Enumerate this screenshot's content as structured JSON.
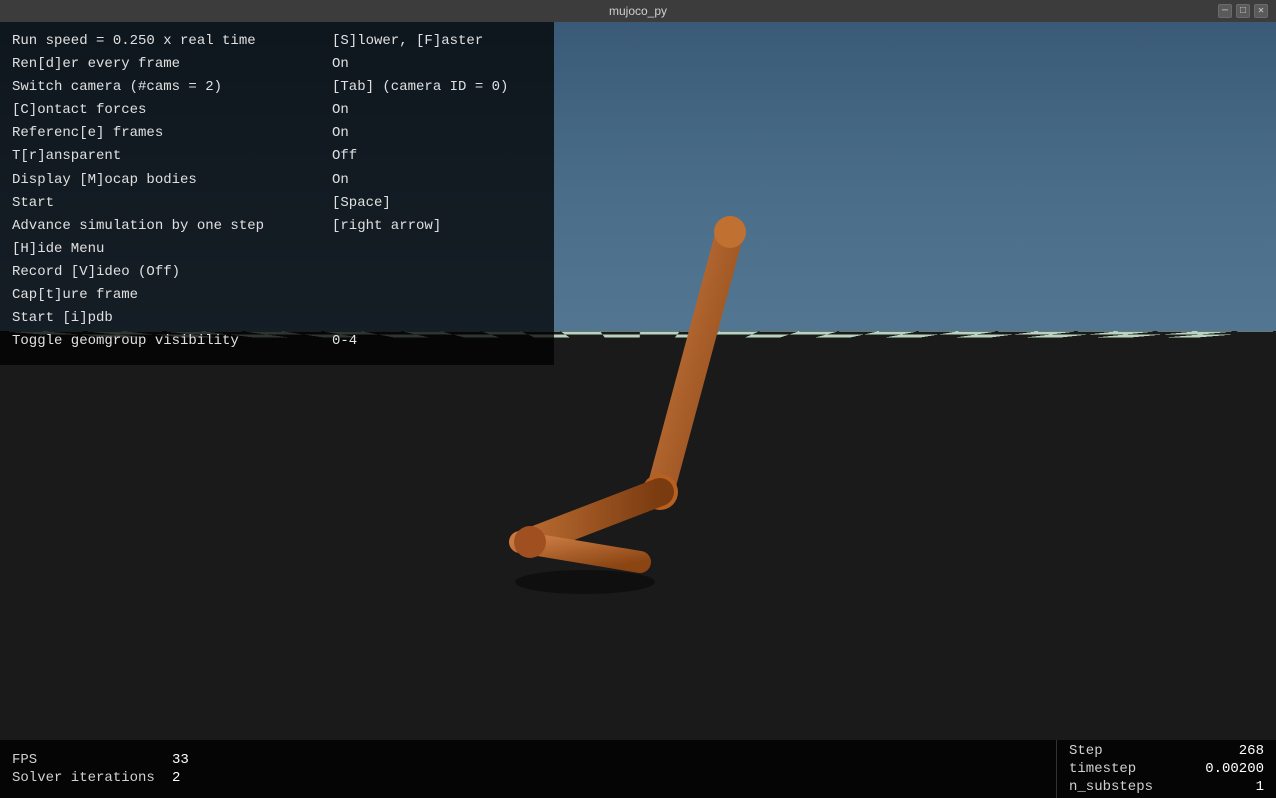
{
  "titlebar": {
    "title": "mujoco_py",
    "controls": [
      "minimize",
      "maximize",
      "close"
    ]
  },
  "menu": {
    "rows": [
      {
        "label": "Run speed = 0.250 x real time",
        "value": "[S]lower, [F]aster"
      },
      {
        "label": "Ren[d]er every frame",
        "value": "On"
      },
      {
        "label": "Switch camera (#cams = 2)",
        "value": "[Tab] (camera ID = 0)"
      },
      {
        "label": "[C]ontact forces",
        "value": "On"
      },
      {
        "label": "Referenc[e] frames",
        "value": "On"
      },
      {
        "label": "T[r]ansparent",
        "value": "Off"
      },
      {
        "label": "Display [M]ocap bodies",
        "value": "On"
      },
      {
        "label": "Start",
        "value": "[Space]"
      },
      {
        "label": "Advance simulation by one step",
        "value": "[right arrow]"
      },
      {
        "label": "[H]ide Menu",
        "value": ""
      },
      {
        "label": "Record [V]ideo (Off)",
        "value": ""
      },
      {
        "label": "Cap[t]ure frame",
        "value": ""
      },
      {
        "label": "Start [i]pdb",
        "value": ""
      },
      {
        "label": "Toggle geomgroup visibility",
        "value": "0-4"
      }
    ]
  },
  "status": {
    "fps_label": "FPS",
    "fps_value": "33",
    "solver_label": "Solver iterations",
    "solver_value": "2"
  },
  "stats": {
    "step_label": "Step",
    "step_value": "268",
    "timestep_label": "timestep",
    "timestep_value": "0.00200",
    "nsubsteps_label": "n_substeps",
    "nsubsteps_value": "1"
  }
}
